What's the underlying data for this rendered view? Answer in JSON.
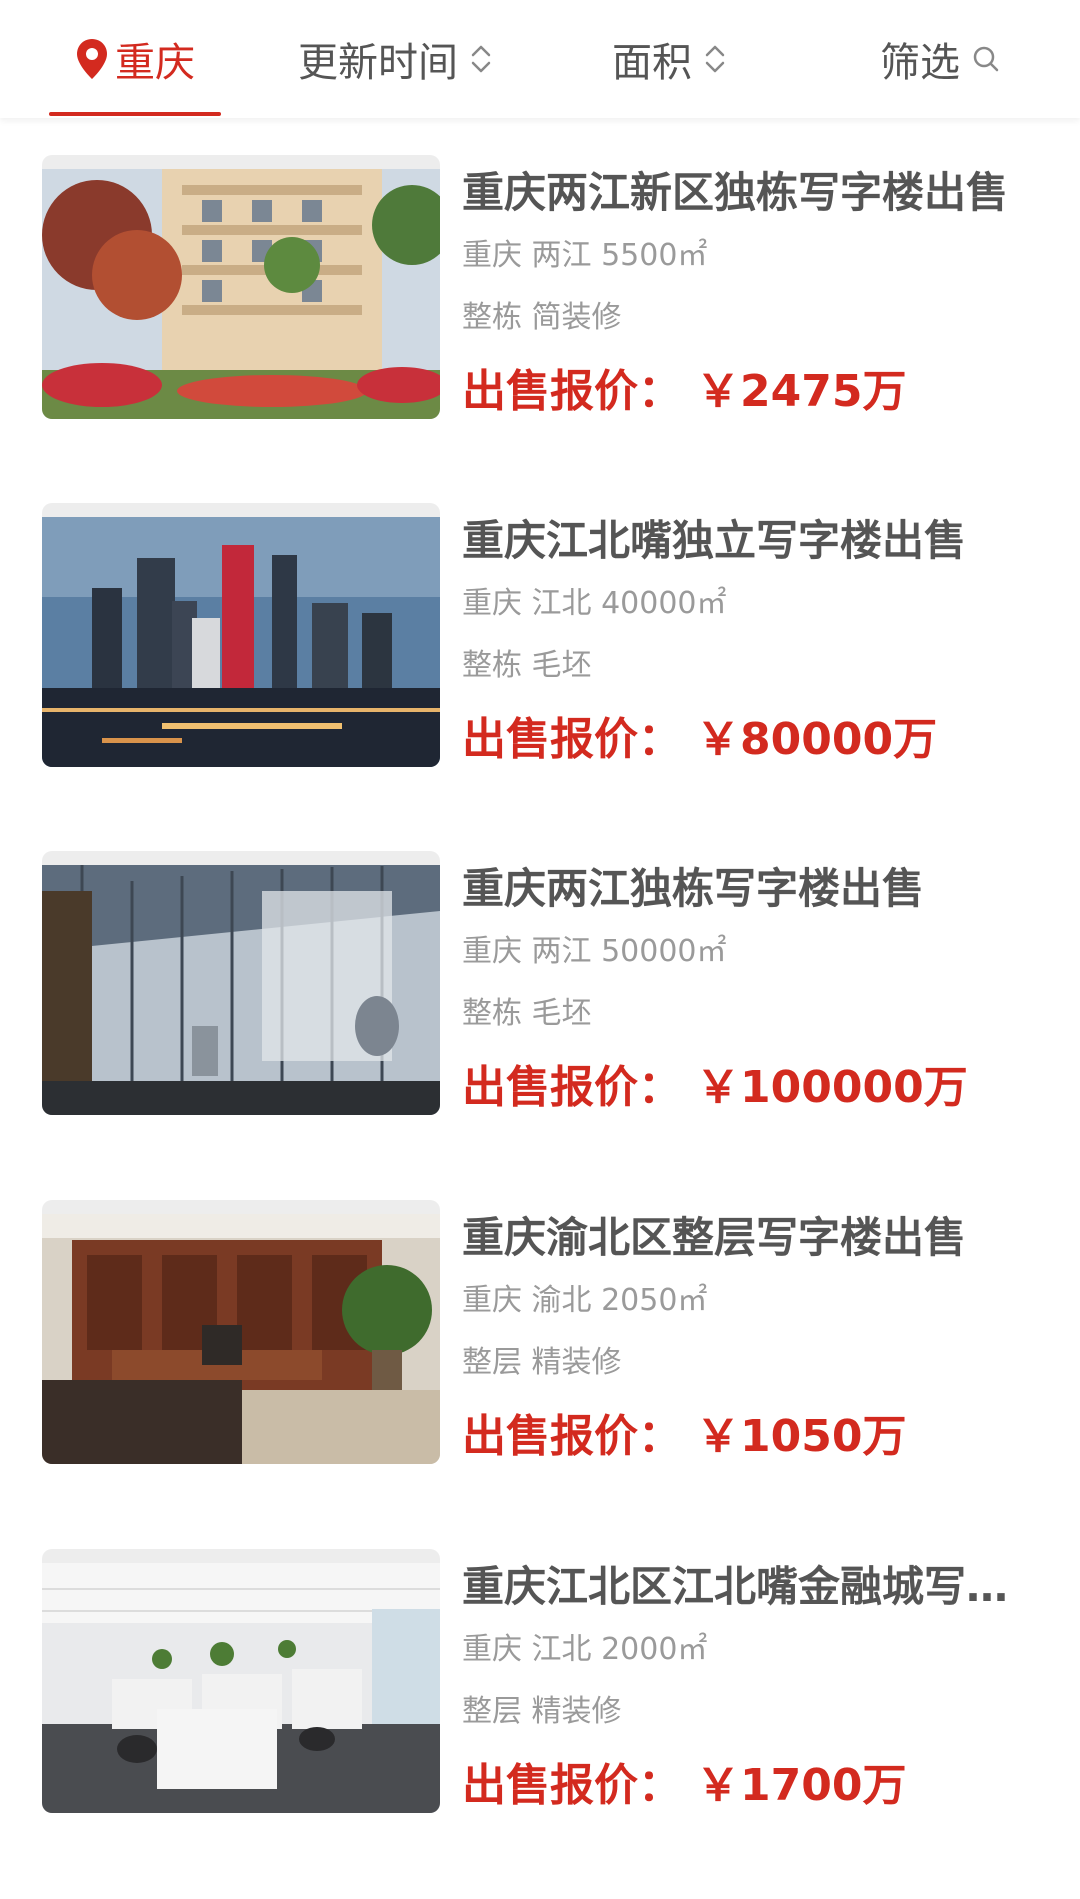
{
  "filters": {
    "city": "重庆",
    "update_time": "更新时间",
    "area": "面积",
    "filter": "筛选"
  },
  "listings": [
    {
      "title": "重庆两江新区独栋写字楼出售",
      "location": "重庆 两江 5500㎡",
      "type": "整栋 简装修",
      "price_label": "出售报价：",
      "price": "￥2475万",
      "image": "building-exterior-photo"
    },
    {
      "title": "重庆江北嘴独立写字楼出售",
      "location": "重庆 江北 40000㎡",
      "type": "整栋 毛坯",
      "price_label": "出售报价：",
      "price": "￥80000万",
      "image": "city-skyline-photo"
    },
    {
      "title": "重庆两江独栋写字楼出售",
      "location": "重庆 两江 50000㎡",
      "type": "整栋 毛坯",
      "price_label": "出售报价：",
      "price": "￥100000万",
      "image": "glass-lobby-photo"
    },
    {
      "title": "重庆渝北区整层写字楼出售",
      "location": "重庆 渝北 2050㎡",
      "type": "整层 精装修",
      "price_label": "出售报价：",
      "price": "￥1050万",
      "image": "executive-office-photo"
    },
    {
      "title": "重庆江北区江北嘴金融城写字楼",
      "location": "重庆 江北 2000㎡",
      "type": "整层 精装修",
      "price_label": "出售报价：",
      "price": "￥1700万",
      "image": "open-office-photo"
    }
  ],
  "colors": {
    "accent": "#d32a1f",
    "title_text": "#555555",
    "meta_text": "#9a9a9a"
  }
}
